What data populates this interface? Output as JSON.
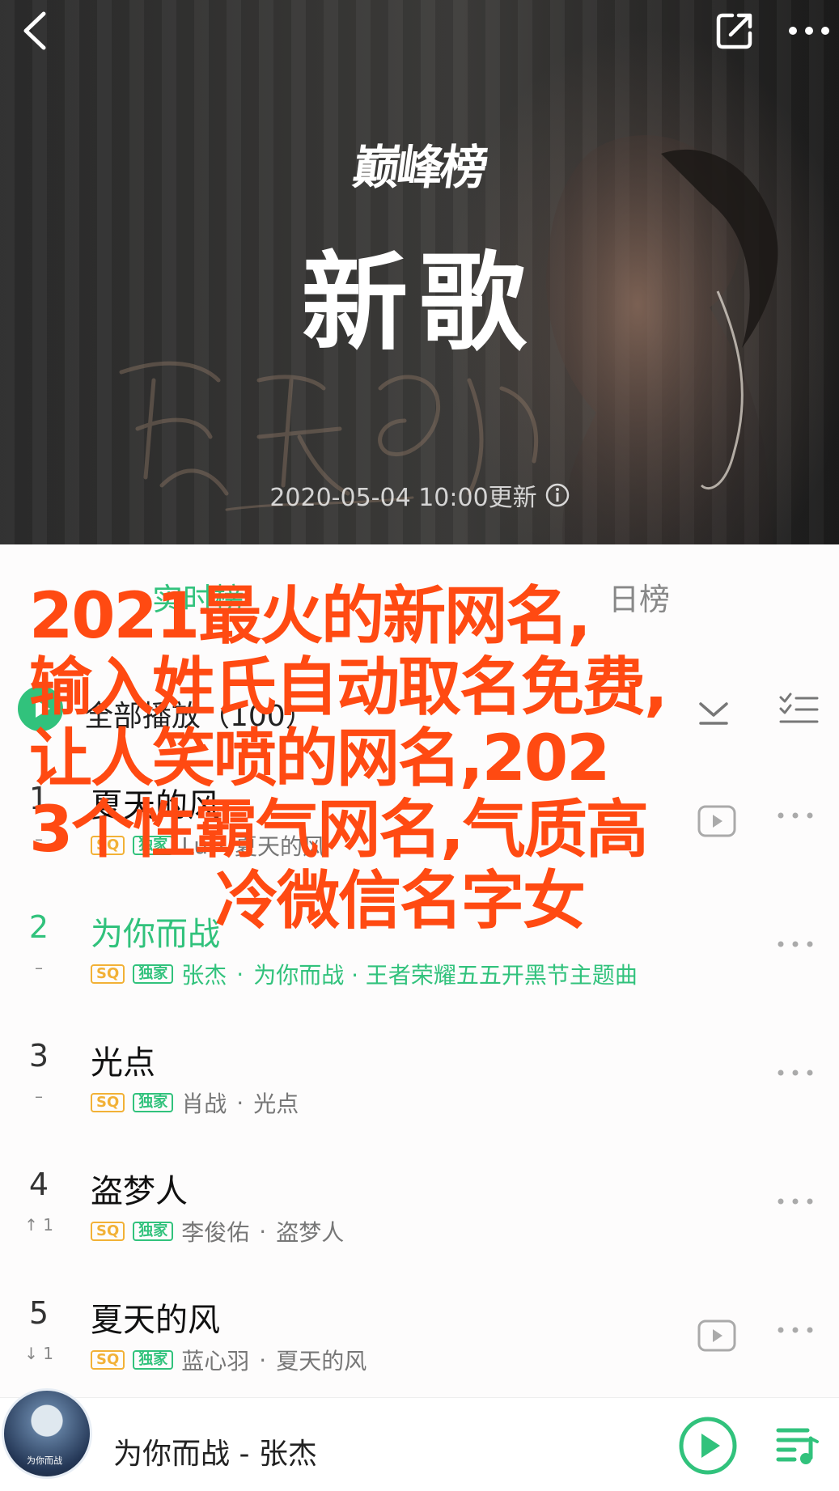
{
  "header": {
    "brand": "巅峰榜",
    "title": "新歌",
    "update_time": "2020-05-04  10:00更新"
  },
  "tabs": [
    {
      "label": "实时榜"
    },
    {
      "label": "日榜"
    }
  ],
  "play_all": {
    "label": "全部播放（100）"
  },
  "songs": [
    {
      "rank": "1",
      "trend": "–",
      "title": "夏天的风",
      "badges": [
        "SQ",
        "独家"
      ],
      "artist": "Lu",
      "album": "夏天的风",
      "has_mv": true
    },
    {
      "rank": "2",
      "trend": "–",
      "title": "为你而战",
      "badges": [
        "SQ",
        "独家"
      ],
      "artist": "张杰",
      "album": "为你而战 · 王者荣耀五五开黑节主题曲",
      "has_mv": false,
      "active": true
    },
    {
      "rank": "3",
      "trend": "–",
      "title": "光点",
      "badges": [
        "SQ",
        "独家"
      ],
      "artist": "肖战",
      "album": "光点",
      "has_mv": false
    },
    {
      "rank": "4",
      "trend": "↑ 1",
      "title": "盗梦人",
      "badges": [
        "SQ",
        "独家"
      ],
      "artist": "李俊佑",
      "album": "盗梦人",
      "has_mv": false
    },
    {
      "rank": "5",
      "trend": "↓ 1",
      "title": "夏天的风",
      "badges": [
        "SQ",
        "独家"
      ],
      "artist": "蓝心羽",
      "album": "夏天的风",
      "has_mv": true
    }
  ],
  "overlay_lines": [
    "2021最火的新网名,",
    "输入姓氏自动取名免费,",
    "让人笑喷的网名,202",
    "3个性霸气网名,气质高",
    "冷微信名字女"
  ],
  "player": {
    "now_playing": "为你而战 - 张杰",
    "cover_text": "为你而战"
  },
  "colors": {
    "accent": "#31c27c",
    "sq_badge": "#f2b136",
    "overlay_text": "#ff4a12"
  },
  "icons": [
    "back-icon",
    "share-icon",
    "more-icon",
    "info-icon",
    "download-icon",
    "multi-select-icon",
    "mv-icon",
    "play-icon",
    "playlist-icon"
  ]
}
